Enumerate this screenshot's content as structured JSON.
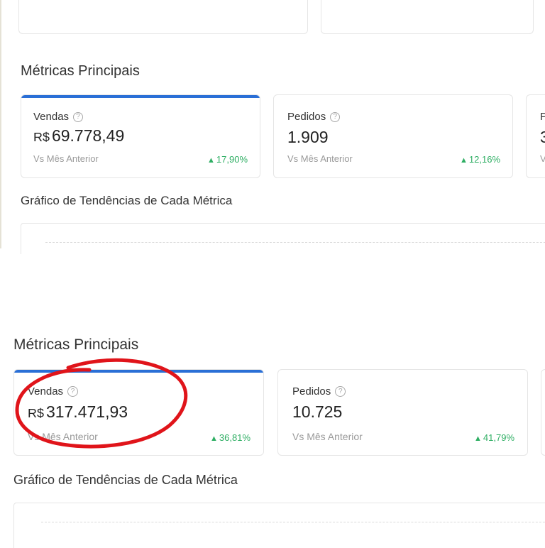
{
  "colors": {
    "accent": "#2a6fd6",
    "positive": "#2eae63",
    "annotation": "#e0141a"
  },
  "top": {
    "section_title": "Métricas Principais",
    "cards": [
      {
        "label": "Vendas",
        "currency": "R$",
        "value": "69.778,49",
        "compare": "Vs Mês Anterior",
        "change": "17,90%",
        "trend_icon": "up-triangle-icon",
        "help_icon": "question-circle-icon",
        "selected": true
      },
      {
        "label": "Pedidos",
        "currency": "",
        "value": "1.909",
        "compare": "Vs Mês Anterior",
        "change": "12,16%",
        "trend_icon": "up-triangle-icon",
        "help_icon": "question-circle-icon",
        "selected": false
      },
      {
        "label": "P",
        "currency": "",
        "value": "3",
        "compare": "V",
        "change": "",
        "selected": false
      }
    ],
    "chart_title": "Gráfico de Tendências de Cada Métrica"
  },
  "bottom": {
    "section_title": "Métricas Principais",
    "cards": [
      {
        "label": "Vendas",
        "currency": "R$",
        "value": "317.471,93",
        "compare": "Vs Mês Anterior",
        "change": "36,81%",
        "trend_icon": "up-triangle-icon",
        "help_icon": "question-circle-icon",
        "selected": true
      },
      {
        "label": "Pedidos",
        "currency": "",
        "value": "10.725",
        "compare": "Vs Mês Anterior",
        "change": "41,79%",
        "trend_icon": "up-triangle-icon",
        "help_icon": "question-circle-icon",
        "selected": false
      }
    ],
    "chart_title": "Gráfico de Tendências de Cada Métrica"
  }
}
